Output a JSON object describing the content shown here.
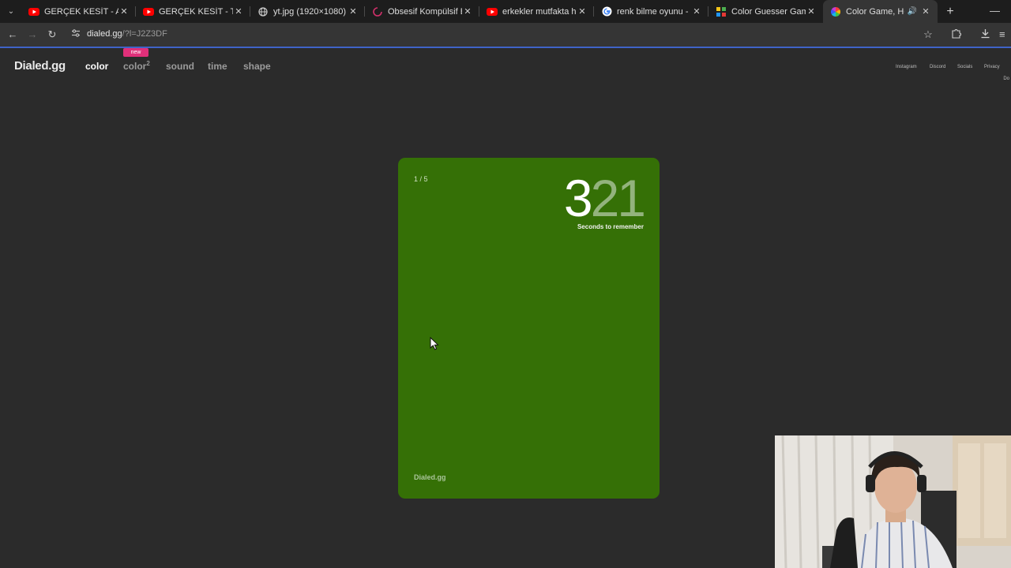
{
  "browser": {
    "tabs": [
      {
        "title": "GERÇEK KESİT - AVCI - Yo",
        "icon": "youtube-icon",
        "active": false
      },
      {
        "title": "GERÇEK KESİT - TEHLİKELİ",
        "icon": "youtube-icon",
        "active": false
      },
      {
        "title": "yt.jpg (1920×1080)",
        "icon": "globe-icon",
        "active": false
      },
      {
        "title": "Obsesif Kompülsif Bozukl",
        "icon": "loading-icon",
        "active": false
      },
      {
        "title": "erkekler mutfakta her işi y",
        "icon": "youtube-icon",
        "active": false
      },
      {
        "title": "renk bilme oyunu - Goog",
        "icon": "google-icon",
        "active": false
      },
      {
        "title": "Color Guesser Game | Gu",
        "icon": "grid-icon",
        "active": false
      },
      {
        "title": "Color Game, How We",
        "icon": "color-wheel-icon",
        "active": true
      }
    ],
    "address": {
      "domain": "dialed.gg",
      "path": "/?l=J2Z3DF"
    }
  },
  "site": {
    "logo": "Dialed.gg",
    "nav": [
      {
        "label": "color",
        "active": true
      },
      {
        "label": "color",
        "sup": "2",
        "active": false
      },
      {
        "label": "sound",
        "active": false
      },
      {
        "label": "time",
        "active": false
      },
      {
        "label": "shape",
        "active": false
      }
    ],
    "new_badge": "new",
    "right_links": [
      "Instagram",
      "Discord",
      "Socials",
      "Privacy"
    ],
    "right_cutoff": "Do"
  },
  "card": {
    "color": "#357006",
    "counter": "1 / 5",
    "countdown_current": "3",
    "countdown_rest": "21",
    "caption": "Seconds to remember",
    "brand": "Dialed.gg"
  },
  "colors": {
    "accent_badge": "#e0307a",
    "page_bg": "#2b2b2b",
    "loading_bar": "#3f63c8"
  }
}
